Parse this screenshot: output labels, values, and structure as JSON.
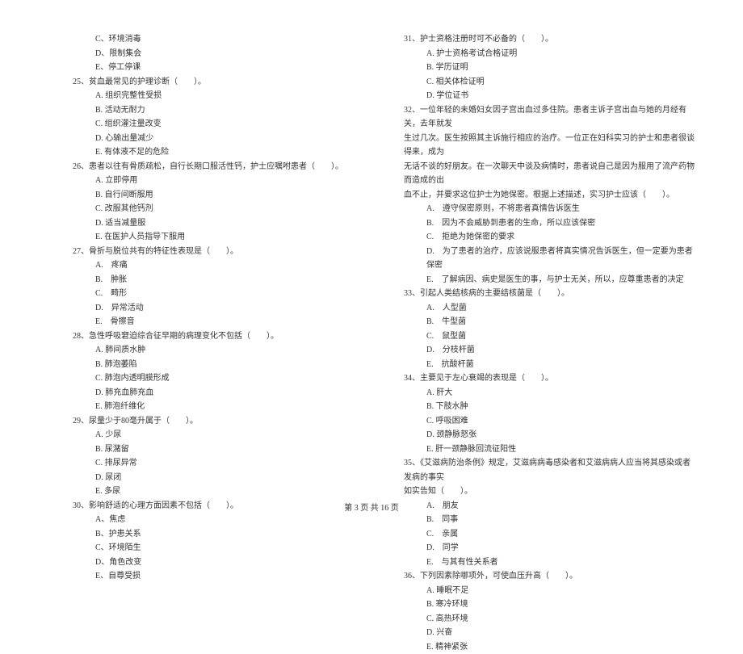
{
  "left": {
    "q24_opts": {
      "c": "C、环境消毒",
      "d": "D、限制集会",
      "e": "E、停工停课"
    },
    "q25": "25、贫血最常见的护理诊断（　　）。",
    "q25_opts": {
      "a": "A. 组织完整性受损",
      "b": "B. 活动无耐力",
      "c": "C. 组织灌注量改变",
      "d": "D. 心输出量减少",
      "e": "E. 有体液不足的危险"
    },
    "q26": "26、患者以往有骨质疏松，自行长期口服活性钙，护士应嘱咐患者（　　）。",
    "q26_opts": {
      "a": "A. 立即停用",
      "b": "B. 自行间断服用",
      "c": "C. 改服其他钙剂",
      "d": "D. 适当减量服",
      "e": "E. 在医护人员指导下服用"
    },
    "q27": "27、骨折与脱位共有的特征性表现是（　　）。",
    "q27_opts": {
      "a": "A.　疼痛",
      "b": "B.　肿胀",
      "c": "C.　畸形",
      "d": "D.　异常活动",
      "e": "E.　骨擦音"
    },
    "q28": "28、急性呼吸窘迫综合征早期的病理变化不包括（　　）。",
    "q28_opts": {
      "a": "A. 肺间质水肿",
      "b": "B. 肺泡萎陷",
      "c": "C. 肺泡内透明膜形成",
      "d": "D. 肺充血肺充血",
      "e": "E. 肺泡纤维化"
    },
    "q29": "29、尿量少于80毫升属于（　　）。",
    "q29_opts": {
      "a": "A. 少尿",
      "b": "B. 尿潴留",
      "c": "C. 排尿异常",
      "d": "D. 尿闭",
      "e": "E. 多尿"
    },
    "q30": "30、影响舒适的心理方面因素不包括（　　）。",
    "q30_opts": {
      "a": "A、焦虑",
      "b": "B、护患关系",
      "c": "C、环境陌生",
      "d": "D、角色改变",
      "e": "E、自尊受损"
    }
  },
  "right": {
    "q31": "31、护士资格注册时可不必备的（　　）。",
    "q31_opts": {
      "a": "A. 护士资格考试合格证明",
      "b": "B. 学历证明",
      "c": "C. 相关体检证明",
      "d": "D. 学位证书"
    },
    "q32_l1": "32、一位年轻的未婚妇女因子宫出血过多住院。患者主诉子宫出血与她的月经有关，去年就发",
    "q32_l2": "生过几次。医生按照其主诉施行相应的治疗。一位正在妇科实习的护士和患者很谈得来，成为",
    "q32_l3": "无话不谈的好朋友。在一次聊天中谈及病情时，患者说自己是因为服用了流产药物而造成的出",
    "q32_l4": "血不止，并要求这位护士为她保密。根据上述描述，实习护士应该（　　）。",
    "q32_opts": {
      "a": "A.　遵守保密原则，不将患者真情告诉医生",
      "b": "B.　因为不会威胁到患者的生命，所以应该保密",
      "c": "C.　拒绝为她保密的要求",
      "d": "D.　为了患者的治疗，应该说服患者将真实情况告诉医生，但一定要为患者保密",
      "e": "E.　了解病因、病史是医生的事，与护士无关，所以，应尊重患者的决定"
    },
    "q33": "33、引起人类结核病的主要结核菌是（　　）。",
    "q33_opts": {
      "a": "A.　人型菌",
      "b": "B.　牛型菌",
      "c": "C.　鼠型菌",
      "d": "D.　分枝杆菌",
      "e": "E.　抗酸杆菌"
    },
    "q34": "34、主要见于左心衰竭的表现是（　　）。",
    "q34_opts": {
      "a": "A. 肝大",
      "b": "B. 下肢水肿",
      "c": "C. 呼吸困难",
      "d": "D. 颈静脉怒张",
      "e": "E. 肝一颈静脉回流征阳性"
    },
    "q35_l1": "35、《艾滋病防治条例》规定，艾滋病病毒感染者和艾滋病病人应当将其感染或者发病的事实",
    "q35_l2": "如实告知（　　）。",
    "q35_opts": {
      "a": "A.　朋友",
      "b": "B.　同事",
      "c": "C.　亲属",
      "d": "D.　同学",
      "e": "E.　与其有性关系者"
    },
    "q36": "36、下列因素除哪项外，可使血压升高（　　）。",
    "q36_opts": {
      "a": "A. 睡眠不足",
      "b": "B. 寒冷环境",
      "c": "C. 高热环境",
      "d": "D. 兴奋",
      "e": "E. 精神紧张"
    }
  },
  "footer": "第 3 页 共 16 页"
}
